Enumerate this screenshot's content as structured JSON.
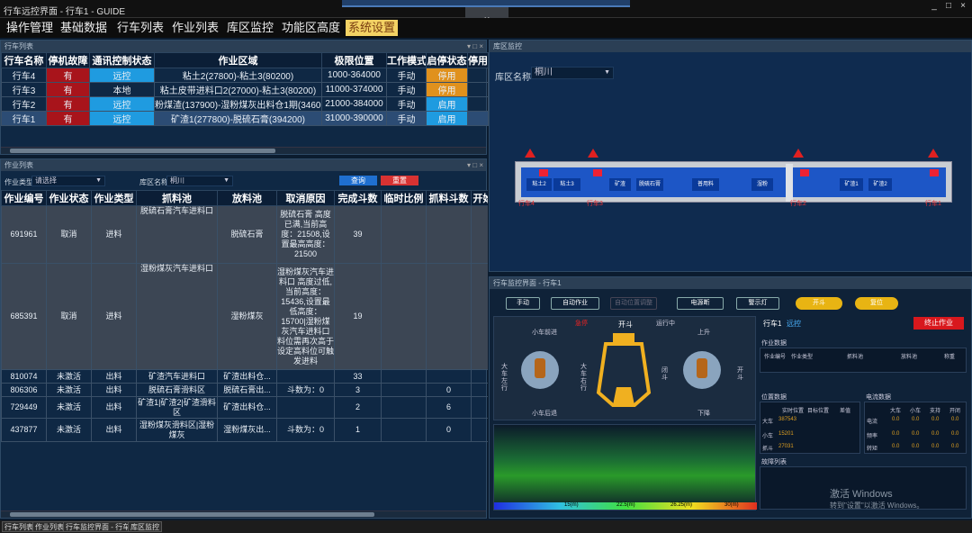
{
  "window": {
    "title": "行车远控界面 - 行车1 - GUIDE",
    "controls": [
      "_",
      "□",
      "×"
    ]
  },
  "menu": [
    "操作管理",
    "基础数据",
    "行车列表",
    "作业列表",
    "库区监控",
    "功能区高度",
    "系统设置"
  ],
  "crane_panel": {
    "title": "行车列表",
    "columns": [
      "行车名称",
      "停机故障",
      "通讯控制状态",
      "作业区域",
      "极限位置",
      "工作模式",
      "启停状态",
      "停用"
    ],
    "rows": [
      {
        "name": "行车4",
        "fault": "有",
        "comm": "远控",
        "area": "粘土2(27800)-粘土3(80200)",
        "limit": "1000-364000",
        "mode": "手动",
        "state": "停用"
      },
      {
        "name": "行车3",
        "fault": "有",
        "comm": "本地",
        "area": "粘土皮带进料口2(27000)-粘土3(80200)",
        "limit": "11000-374000",
        "mode": "手动",
        "state": "停用"
      },
      {
        "name": "行车2",
        "fault": "有",
        "comm": "远控",
        "area": "粉煤渣(137900)-湿粉煤灰出料仓1期(346000)",
        "limit": "21000-384000",
        "mode": "手动",
        "state": "启用"
      },
      {
        "name": "行车1",
        "fault": "有",
        "comm": "远控",
        "area": "矿渣1(277800)-脱硫石膏(394200)",
        "limit": "31000-390000",
        "mode": "手动",
        "state": "启用"
      }
    ]
  },
  "job_panel": {
    "title": "作业列表",
    "type_label": "作业类型",
    "type_value": "请选择",
    "area_label": "库区名称",
    "area_value": "桐川",
    "query": "查询",
    "reset": "重置",
    "columns": [
      "作业编号",
      "作业状态",
      "作业类型",
      "抓料池",
      "放料池",
      "取消原因",
      "完成斗数",
      "临时比例",
      "抓料斗数",
      "开始"
    ],
    "rows": [
      {
        "id": "691961",
        "status": "取消",
        "type": "进料",
        "grab": "脱硫石膏汽车进料口",
        "drop": "脱硫石膏",
        "reason": "脱硫石膏 高度已满,当前高度：21508,设置最高高度：21500",
        "done": "39",
        "ratio": "",
        "count": ""
      },
      {
        "id": "685391",
        "status": "取消",
        "type": "进料",
        "grab": "湿粉煤灰汽车进料口",
        "drop": "湿粉煤灰",
        "reason": "湿粉煤灰汽车进料口 高度过低,当前高度：15436,设置最低高度：15700|湿粉煤灰汽车进料口 料位需再次高于设定高料位可触发进料",
        "done": "19",
        "ratio": "",
        "count": ""
      },
      {
        "id": "810074",
        "status": "未激活",
        "type": "出料",
        "grab": "矿渣汽车进料口",
        "drop": "矿渣出料仓...",
        "reason": "",
        "done": "33",
        "ratio": "",
        "count": ""
      },
      {
        "id": "806306",
        "status": "未激活",
        "type": "出料",
        "grab": "脱硫石膏滑料区",
        "drop": "脱硫石膏出...",
        "reason": "斗数为：0",
        "done": "3",
        "ratio": "",
        "count": "0"
      },
      {
        "id": "729449",
        "status": "未激活",
        "type": "出料",
        "grab": "矿渣1|矿渣2|矿渣滑料区",
        "drop": "矿渣出料仓...",
        "reason": "",
        "done": "2",
        "ratio": "",
        "count": "6"
      },
      {
        "id": "437877",
        "status": "未激活",
        "type": "出料",
        "grab": "湿粉煤灰滑料区|湿粉煤灰",
        "drop": "湿粉煤灰出...",
        "reason": "斗数为：0",
        "done": "1",
        "ratio": "",
        "count": "0"
      }
    ]
  },
  "yard_panel": {
    "title": "库区监控",
    "area_label": "库区名称",
    "area_value": "桐川",
    "bays": [
      "粘土2",
      "粘土3",
      "矿渣",
      "脱硫石膏",
      "普用料",
      "湿粉",
      "矿渣1",
      "矿渣2"
    ],
    "crane_tags": [
      "行车4",
      "行车3",
      "行车2",
      "行车1"
    ]
  },
  "monitor": {
    "title": "行车监控界面 - 行车1",
    "buttons": [
      "手动",
      "自动作业",
      "自动位置调整",
      "电源断",
      "警示灯",
      "开斗",
      "复位"
    ],
    "crane": "行车1",
    "mode": "远控",
    "stop": "终止作业",
    "grab_state": "开斗",
    "status_labels": [
      "急停",
      "运行中"
    ],
    "dirs": {
      "trolley_fwd": "小车前进",
      "trolley_back": "小车后退",
      "hoist_up": "上升",
      "hoist_down": "下降",
      "cart_left": "大车左行",
      "cart_right": "大车右行",
      "close": "闭斗",
      "open": "开斗"
    },
    "job_section": "作业数据",
    "job_cols": [
      "作业编号",
      "作业类型",
      "抓料池",
      "放料池",
      "称重"
    ],
    "pos_section": "位置数据",
    "pos_cols": [
      "实时位置",
      "目标位置",
      "差值"
    ],
    "pos_rows": [
      {
        "name": "大车",
        "v": "387543"
      },
      {
        "name": "小车",
        "v": "15201"
      },
      {
        "name": "抓斗",
        "v": "27031"
      }
    ],
    "cur_section": "电流数据",
    "cur_cols": [
      "大车",
      "小车",
      "支持",
      "开闭"
    ],
    "cur_rows": [
      {
        "name": "电流",
        "v": [
          "0.0",
          "0.0",
          "0.0",
          "0.0"
        ]
      },
      {
        "name": "频率",
        "v": [
          "0.0",
          "0.0",
          "0.0",
          "0.0"
        ]
      },
      {
        "name": "转矩",
        "v": [
          "0.0",
          "0.0",
          "0.0",
          "0.0"
        ]
      }
    ],
    "fault_section": "故障列表",
    "legend": [
      "15(m)",
      "22.5(m)",
      "26.25(m)",
      "30(m)"
    ],
    "activate": "激活 Windows",
    "activate_sub": "转到\"设置\"以激活 Windows。"
  },
  "status_tabs": [
    "行车列表",
    "作业列表",
    "行车监控界面 - 行车1",
    "库区监控"
  ],
  "colors": {
    "accent_blue": "#1f9be0",
    "fault_red": "#a8141b",
    "stop_orange": "#e0911d",
    "yellow": "#e8b413"
  }
}
